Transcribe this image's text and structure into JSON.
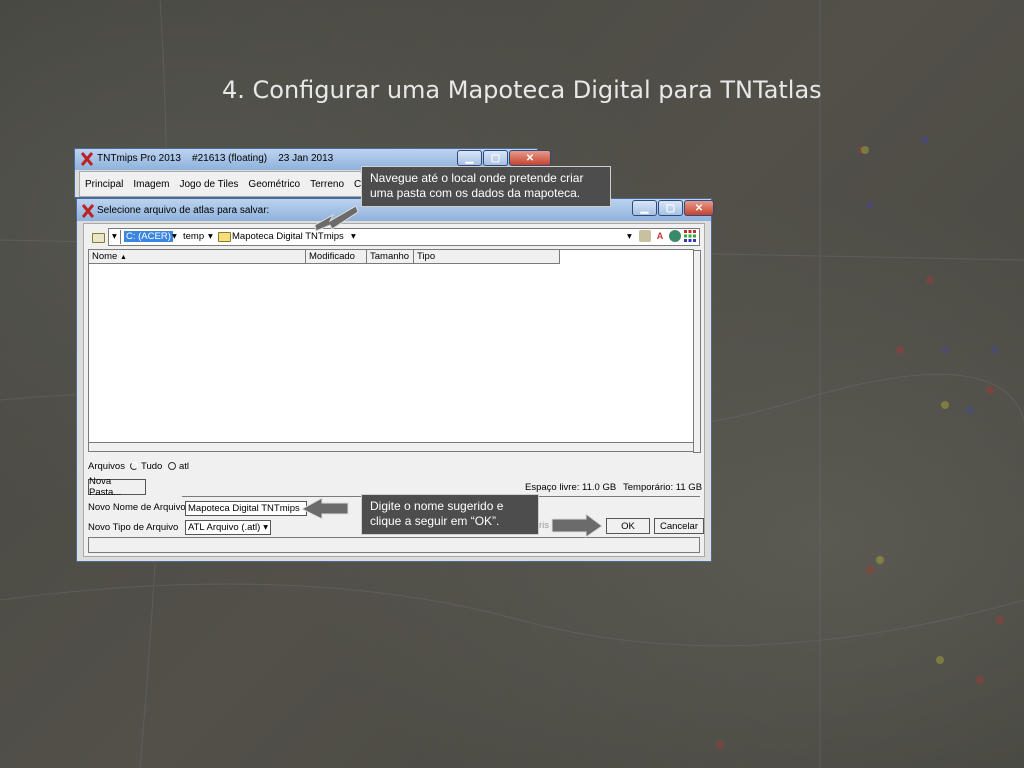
{
  "slide": {
    "title": "4. Configurar uma Mapoteca Digital para TNTatlas"
  },
  "main_window": {
    "title": "TNTmips Pro 2013    #21613 (floating)    23 Jan 2013",
    "menu": [
      "Principal",
      "Imagem",
      "Jogo de Tiles",
      "Geométrico",
      "Terreno",
      "Co"
    ]
  },
  "dialog": {
    "title": "Selecione arquivo de atlas para salvar:",
    "path": {
      "drive": "C: (ACER)",
      "folder1": "temp",
      "folder2": "Mapoteca Digital TNTmips"
    },
    "columns": [
      "Nome",
      "Modificado",
      "Tamanho",
      "Tipo"
    ],
    "arquivos_label": "Arquivos",
    "radio_all": "Tudo",
    "radio_atl": "atl",
    "new_folder_button": "Nova Pasta...",
    "free_space": "Espaço livre: 11.0 GB",
    "temp_space": "Temporário: 11 GB",
    "new_file_name_label": "Novo Nome de Arquivo",
    "new_file_name_value": "Mapoteca Digital TNTmips",
    "new_file_type_label": "Novo Tipo de Arquivo",
    "new_file_type_value": "ATL Arquivo (.atl)",
    "partial_label": "ris",
    "ok_button": "OK",
    "cancel_button": "Cancelar"
  },
  "callouts": {
    "navigate": "Navegue até o local onde pretende criar uma pasta com os dados da mapoteca.",
    "type_name": "Digite o nome sugerido e clique a seguir em “OK”."
  },
  "colors": {
    "background": "#4a4a45",
    "selection": "#3a86e0",
    "callout_bg": "#4d4d4d",
    "close_button": "#c5432e"
  }
}
